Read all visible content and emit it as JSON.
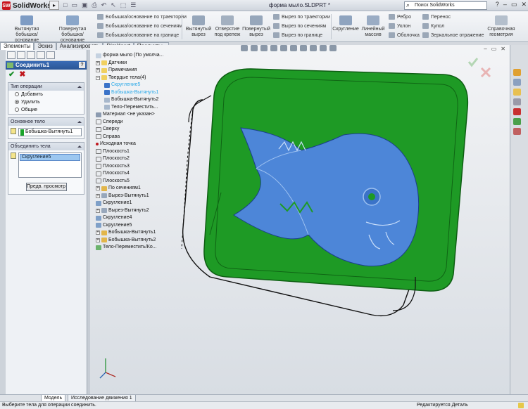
{
  "app": {
    "brand": "SolidWorks",
    "doc_title": "форма мыло.SLDPRT *",
    "search_placeholder": "Поиск SolidWorks"
  },
  "ribbon": {
    "big": [
      {
        "label": "Вытянутая бобышка/основание"
      },
      {
        "label": "Повернутая бобышка/основание"
      },
      {
        "label": "Вытянутый вырез"
      },
      {
        "label": "Отверстие под крепеж"
      },
      {
        "label": "Повернутый вырез"
      },
      {
        "label": "Скругление"
      },
      {
        "label": "Линейный массив"
      },
      {
        "label": "Справочная геометрия"
      }
    ],
    "rows": [
      {
        "label": "Бобышка/основание по траектории"
      },
      {
        "label": "Бобышка/основание по сечениям"
      },
      {
        "label": "Бобышка/основание на границе"
      },
      {
        "label": "Вырез по траектории"
      },
      {
        "label": "Вырез по сечениям"
      },
      {
        "label": "Вырез по границе"
      },
      {
        "label": "Ребро"
      },
      {
        "label": "Уклон"
      },
      {
        "label": "Оболочка"
      },
      {
        "label": "Перенос"
      },
      {
        "label": "Купол"
      },
      {
        "label": "Зеркальное отражение"
      }
    ]
  },
  "tabs": [
    "Элементы",
    "Эскиз",
    "Анализировать",
    "DimXpert",
    "Продукты Office"
  ],
  "property_manager": {
    "title": "Соединить1",
    "operation_group": "Тип операции",
    "options": [
      "Добавить",
      "Удалить",
      "Общие"
    ],
    "selected_option": "Удалить",
    "main_body_group": "Основное тело",
    "main_body_value": "Бобышка-Вытянуть1",
    "combine_group": "Объединить тела",
    "combine_value": "Скругление5",
    "preview_button": "Предв. просмотр"
  },
  "tree": [
    {
      "label": "форма мыло  (По умолча...",
      "kind": "part"
    },
    {
      "label": "Датчики",
      "kind": "sensor"
    },
    {
      "label": "Примечания",
      "kind": "note"
    },
    {
      "label": "Твердые тела(4)",
      "kind": "folder"
    },
    {
      "label": "Скругление5",
      "kind": "body",
      "highlight": true
    },
    {
      "label": "Бобышка-Вытянуть1",
      "kind": "body",
      "highlight": true
    },
    {
      "label": "Бобышка-Вытянуть2",
      "kind": "body"
    },
    {
      "label": "Тело-Переместить...",
      "kind": "body"
    },
    {
      "label": "Материал <не указан>",
      "kind": "material"
    },
    {
      "label": "Спереди",
      "kind": "plane"
    },
    {
      "label": "Сверху",
      "kind": "plane"
    },
    {
      "label": "Справа",
      "kind": "plane"
    },
    {
      "label": "Исходная точка",
      "kind": "origin"
    },
    {
      "label": "Плоскость1",
      "kind": "plane"
    },
    {
      "label": "Плоскость2",
      "kind": "plane"
    },
    {
      "label": "Плоскость3",
      "kind": "plane"
    },
    {
      "label": "Плоскость4",
      "kind": "plane"
    },
    {
      "label": "Плоскость5",
      "kind": "plane"
    },
    {
      "label": "По сечениям1",
      "kind": "feature"
    },
    {
      "label": "Вырез-Вытянуть1",
      "kind": "feature"
    },
    {
      "label": "Скругление1",
      "kind": "feature"
    },
    {
      "label": "Вырез-Вытянуть2",
      "kind": "feature"
    },
    {
      "label": "Скругление4",
      "kind": "feature"
    },
    {
      "label": "Скругление5",
      "kind": "feature"
    },
    {
      "label": "Бобышка-Вытянуть1",
      "kind": "feature"
    },
    {
      "label": "Бобышка-Вытянуть2",
      "kind": "feature"
    },
    {
      "label": "Тело-Переместить/Ко...",
      "kind": "feature"
    }
  ],
  "bottom_tabs": [
    "Модель",
    "Исследование движения 1"
  ],
  "status": {
    "left": "Выберите тела для операции соединить.",
    "right": "Редактируется Деталь"
  },
  "colors": {
    "green": "#1e9a25",
    "blue": "#4d86d8",
    "selection": "#29a8e8"
  }
}
